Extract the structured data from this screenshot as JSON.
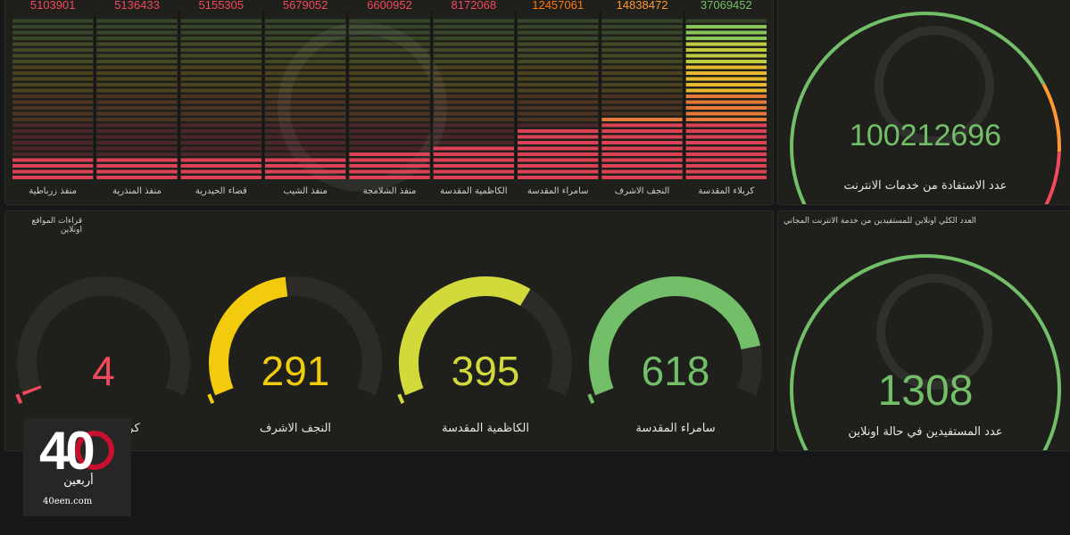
{
  "top_chart": {
    "chart_data": {
      "type": "bar",
      "categories": [
        "منفذ زرباطية",
        "منفذ المنذرية",
        "قضاء الحيدرية",
        "منفذ الشيب",
        "منفذ الشلامجة",
        "الكاظمية المقدسة",
        "سامراء المقدسة",
        "النجف الاشرف",
        "كربلاء المقدسة"
      ],
      "values": [
        5103901,
        5136433,
        5155305,
        5679052,
        6600952,
        8172068,
        12457061,
        14838472,
        37069452
      ],
      "value_labels": [
        "5103901",
        "5136433",
        "5155305",
        "5679052",
        "6600952",
        "8172068",
        "12457061",
        "14838472",
        "37069452"
      ],
      "ylim": [
        0,
        38500000
      ],
      "value_label_colors": [
        "#f2495c",
        "#f2495c",
        "#f2495c",
        "#f2495c",
        "#f2495c",
        "#f2495c",
        "#ff780a",
        "#ff9830",
        "#73bf69"
      ]
    }
  },
  "top_right_gauge": {
    "value": "100212696",
    "label": "عدد الاستفادة من خدمات الانترنت",
    "value_color": "#73bf69"
  },
  "sites_panel": {
    "title": "قراءات المواقع اونلاين",
    "gauges": [
      {
        "value": "4",
        "label": "كربلاء المقدسة",
        "fraction": 0.01,
        "color": "#f2495c"
      },
      {
        "value": "291",
        "label": "النجف الاشرف",
        "fraction": 0.47,
        "color": "#f2cc0c"
      },
      {
        "value": "395",
        "label": "الكاظمية المقدسة",
        "fraction": 0.64,
        "color": "#d2d93b"
      },
      {
        "value": "618",
        "label": "سامراء المقدسة",
        "fraction": 0.85,
        "color": "#73bf69"
      }
    ]
  },
  "online_panel": {
    "title": "العدد الكلي اونلاين للمستفيدين من خدمة الانترنت المجاني",
    "value": "1308",
    "label": "عدد المستفيدين في حالة اونلاين",
    "value_color": "#73bf69"
  },
  "watermark": {
    "number": "40",
    "script": "أربعين",
    "domain": "40een.com"
  }
}
